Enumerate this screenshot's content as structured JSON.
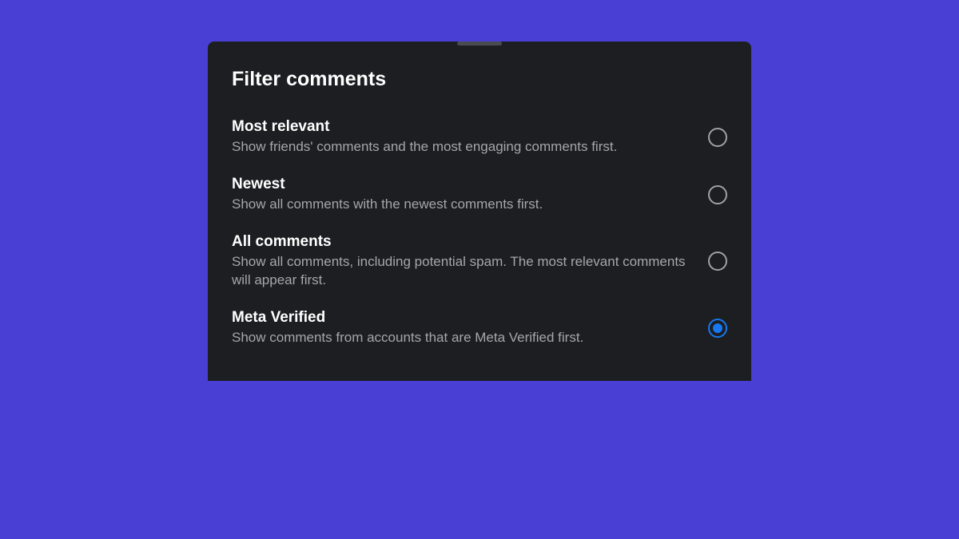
{
  "sheet": {
    "title": "Filter comments",
    "options": [
      {
        "id": "most-relevant",
        "label": "Most relevant",
        "description": "Show friends' comments and the most engaging comments first.",
        "selected": false
      },
      {
        "id": "newest",
        "label": "Newest",
        "description": "Show all comments with the newest comments first.",
        "selected": false
      },
      {
        "id": "all-comments",
        "label": "All comments",
        "description": "Show all comments, including potential spam. The most relevant comments will appear first.",
        "selected": false
      },
      {
        "id": "meta-verified",
        "label": "Meta Verified",
        "description": "Show comments from accounts that are Meta Verified first.",
        "selected": true
      }
    ]
  }
}
